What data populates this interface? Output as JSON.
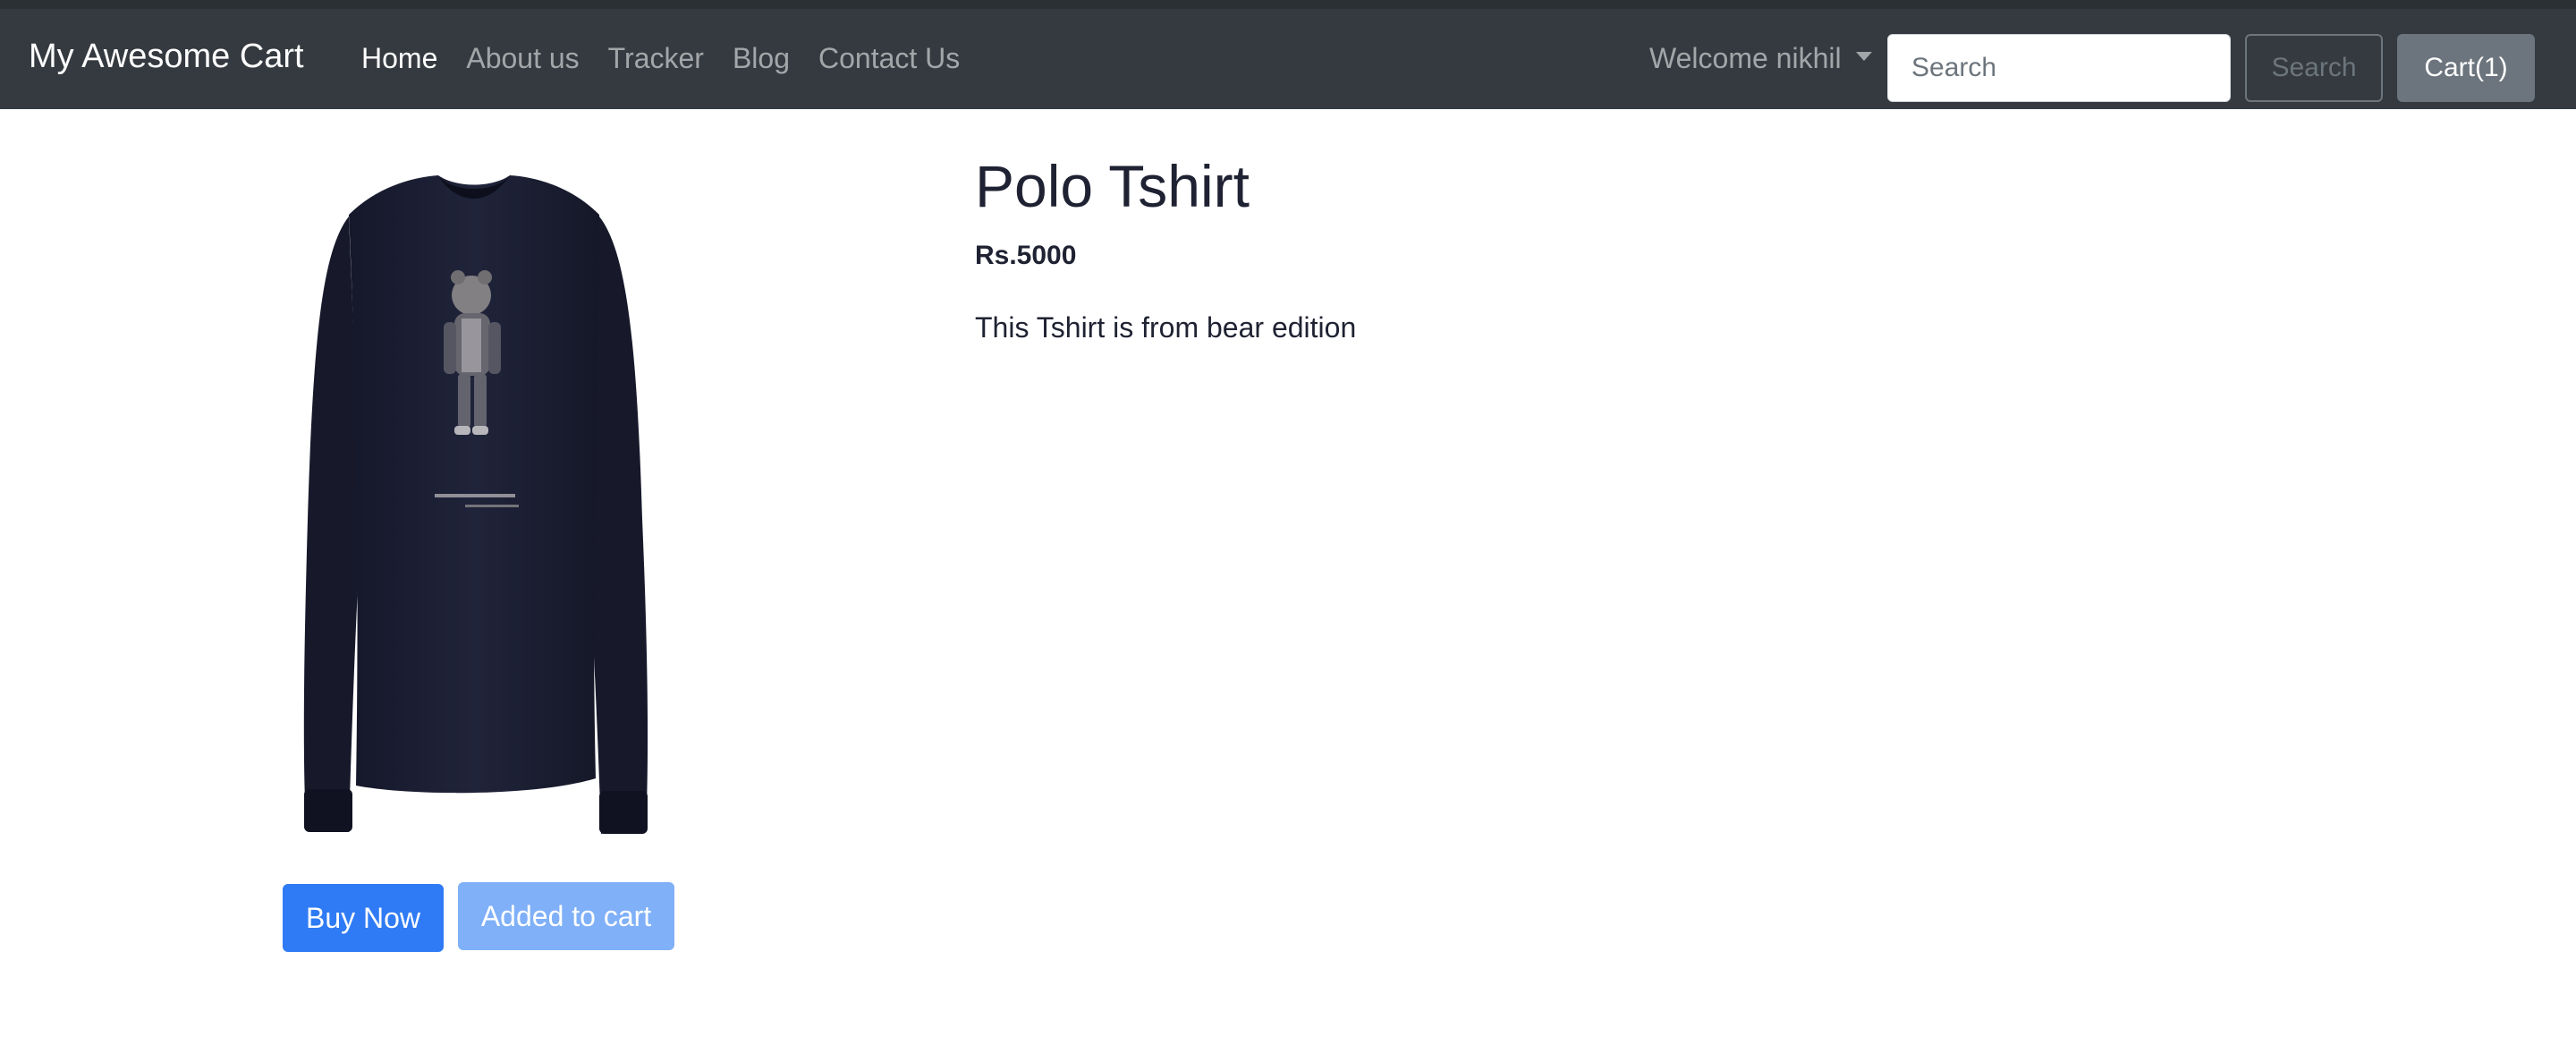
{
  "navbar": {
    "brand": "My Awesome Cart",
    "links": [
      {
        "label": "Home",
        "active": true
      },
      {
        "label": "About us",
        "active": false
      },
      {
        "label": "Tracker",
        "active": false
      },
      {
        "label": "Blog",
        "active": false
      },
      {
        "label": "Contact Us",
        "active": false
      }
    ],
    "user_menu": "Welcome nikhil",
    "search": {
      "placeholder": "Search",
      "value": ""
    },
    "search_button": "Search",
    "cart_button": "Cart(1)"
  },
  "product": {
    "image_icon": "polo-tshirt-image",
    "title": "Polo Tshirt",
    "price": "Rs.5000",
    "description": "This Tshirt is from bear edition",
    "buy_button": "Buy Now",
    "added_button": "Added to cart"
  },
  "colors": {
    "navbar_bg": "#343a40",
    "primary": "#2f7bf5",
    "primary_light": "#7fb0f8",
    "secondary": "#6c757d"
  }
}
